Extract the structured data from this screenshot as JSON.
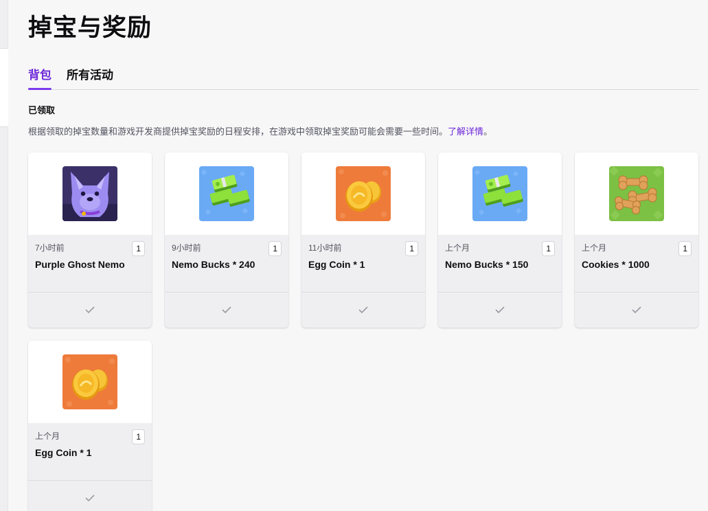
{
  "page": {
    "title": "掉宝与奖励",
    "tabs": [
      {
        "label": "背包",
        "active": true
      },
      {
        "label": "所有活动",
        "active": false
      }
    ],
    "section_title": "已领取",
    "description": "根据领取的掉宝数量和游戏开发商提供掉宝奖励的日程安排，在游戏中领取掉宝奖励可能会需要一些时间。",
    "learn_more": "了解详情",
    "description_end": "。"
  },
  "colors": {
    "accent": "#6d28d9",
    "background": "#f7f7f8",
    "card": "#efeff1"
  },
  "rewards": [
    {
      "time": "7小时前",
      "quantity": "1",
      "name": "Purple Ghost Nemo",
      "icon": "purple-ghost-nemo-icon",
      "status_icon": "check-icon"
    },
    {
      "time": "9小时前",
      "quantity": "1",
      "name": "Nemo Bucks * 240",
      "icon": "nemo-bucks-icon",
      "status_icon": "check-icon"
    },
    {
      "time": "11小时前",
      "quantity": "1",
      "name": "Egg Coin * 1",
      "icon": "egg-coin-icon",
      "status_icon": "check-icon"
    },
    {
      "time": "上个月",
      "quantity": "1",
      "name": "Nemo Bucks * 150",
      "icon": "nemo-bucks-icon",
      "status_icon": "check-icon"
    },
    {
      "time": "上个月",
      "quantity": "1",
      "name": "Cookies * 1000",
      "icon": "cookies-icon",
      "status_icon": "check-icon"
    },
    {
      "time": "上个月",
      "quantity": "1",
      "name": "Egg Coin * 1",
      "icon": "egg-coin-icon",
      "status_icon": "check-icon"
    }
  ]
}
